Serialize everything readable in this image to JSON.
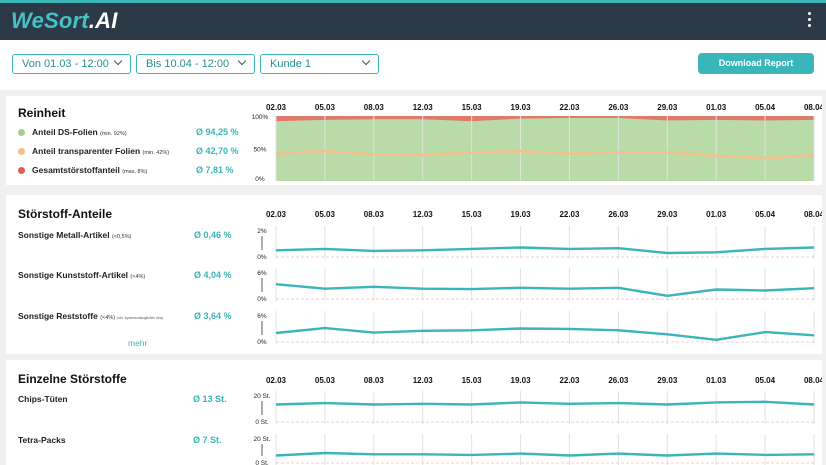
{
  "app": {
    "logo_main": "WeSort",
    "logo_ai": ".AI"
  },
  "filters": {
    "from": "Von 01.03 - 12:00",
    "to": "Bis 10.04 - 12:00",
    "customer": "Kunde 1",
    "download": "Download Report"
  },
  "colors": {
    "accent": "#3ab5b8",
    "green": "#b9dba7",
    "red": "#e07a6d",
    "orange": "#f2c08f",
    "dark": "#2c3a48"
  },
  "dates": [
    "02.03",
    "05.03",
    "08.03",
    "12.03",
    "15.03",
    "19.03",
    "22.03",
    "26.03",
    "29.03",
    "01.03",
    "05.04",
    "08.04"
  ],
  "reinheit": {
    "title": "Reinheit",
    "rows": [
      {
        "label": "Anteil DS-Folien",
        "note": "(min. 92%)",
        "value": "Ø 94,25 %",
        "color": "#9fce8d"
      },
      {
        "label": "Anteil transparenter Folien",
        "note": "(min. 42%)",
        "value": "Ø 42,70 %",
        "color": "#f2c08f"
      },
      {
        "label": "Gesamtstörstoffanteil",
        "note": "(max. 8%)",
        "value": "Ø 7,81 %",
        "color": "#d9614f"
      }
    ],
    "axis": [
      "100%",
      "50%",
      "0%"
    ]
  },
  "stoerstoff": {
    "title": "Störstoff-Anteile",
    "rows": [
      {
        "label": "Sonstige Metall-Artikel",
        "note": "(<0,5%)",
        "extra": "",
        "value": "Ø 0,46 %",
        "axis_top": "2%",
        "axis_bottom": "0%"
      },
      {
        "label": "Sonstige Kunststoff-Artikel",
        "note": "(<4%)",
        "extra": "",
        "value": "Ø 4,04 %",
        "axis_top": "6%",
        "axis_bottom": "0%"
      },
      {
        "label": "Sonstige Reststoffe",
        "note": "(<4%)",
        "extra": "inkl. systemuntauglicher Verp.",
        "value": "Ø 3,64 %",
        "axis_top": "6%",
        "axis_bottom": "0%"
      }
    ],
    "more": "mehr"
  },
  "einzelne": {
    "title": "Einzelne Störstoffe",
    "rows": [
      {
        "label": "Chips-Tüten",
        "value": "Ø 13 St.",
        "axis_top": "20 St.",
        "axis_bottom": "0 St."
      },
      {
        "label": "Tetra-Packs",
        "value": "Ø 7 St.",
        "axis_top": "20 St.",
        "axis_bottom": "0 St."
      }
    ]
  },
  "chart_data": [
    {
      "type": "area",
      "title": "Reinheit",
      "categories": [
        "02.03",
        "05.03",
        "08.03",
        "12.03",
        "15.03",
        "19.03",
        "22.03",
        "26.03",
        "29.03",
        "01.03",
        "05.04",
        "08.04"
      ],
      "ylim": [
        0,
        100
      ],
      "series": [
        {
          "name": "Anteil DS-Folien",
          "values": [
            92,
            94,
            95,
            95,
            92,
            96,
            97,
            97,
            93,
            94,
            93,
            94
          ]
        },
        {
          "name": "Anteil transparenter Folien",
          "values": [
            42,
            46,
            41,
            40,
            44,
            46,
            42,
            44,
            44,
            39,
            35,
            40
          ]
        }
      ]
    },
    {
      "type": "line",
      "title": "Störstoff-Anteile",
      "categories": [
        "02.03",
        "05.03",
        "08.03",
        "12.03",
        "15.03",
        "19.03",
        "22.03",
        "26.03",
        "29.03",
        "01.03",
        "05.04",
        "08.04"
      ],
      "series": [
        {
          "name": "Sonstige Metall-Artikel",
          "ylim": [
            0,
            2
          ],
          "values": [
            0.5,
            0.6,
            0.45,
            0.5,
            0.6,
            0.7,
            0.6,
            0.65,
            0.3,
            0.35,
            0.6,
            0.7
          ]
        },
        {
          "name": "Sonstige Kunststoff-Artikel",
          "ylim": [
            0,
            6
          ],
          "values": [
            3.3,
            2.3,
            2.7,
            2.3,
            2.2,
            2.5,
            2.3,
            2.5,
            0.7,
            2.1,
            1.9,
            2.4
          ]
        },
        {
          "name": "Sonstige Reststoffe",
          "ylim": [
            0,
            6
          ],
          "values": [
            2.0,
            3.1,
            2.1,
            2.5,
            2.6,
            3.0,
            2.9,
            2.6,
            1.7,
            0.5,
            2.2,
            1.5
          ]
        }
      ]
    },
    {
      "type": "line",
      "title": "Einzelne Störstoffe",
      "categories": [
        "02.03",
        "05.03",
        "08.03",
        "12.03",
        "15.03",
        "19.03",
        "22.03",
        "26.03",
        "29.03",
        "01.03",
        "05.04",
        "08.04"
      ],
      "series": [
        {
          "name": "Chips-Tüten",
          "ylim": [
            0,
            20
          ],
          "values": [
            13,
            14,
            13,
            13.5,
            13,
            14.5,
            13.5,
            14,
            13,
            14.5,
            15,
            13
          ]
        },
        {
          "name": "Tetra-Packs",
          "ylim": [
            0,
            20
          ],
          "values": [
            6,
            8,
            7,
            7,
            6.5,
            7.5,
            6,
            7.5,
            6,
            7.5,
            6.5,
            7
          ]
        }
      ]
    }
  ]
}
